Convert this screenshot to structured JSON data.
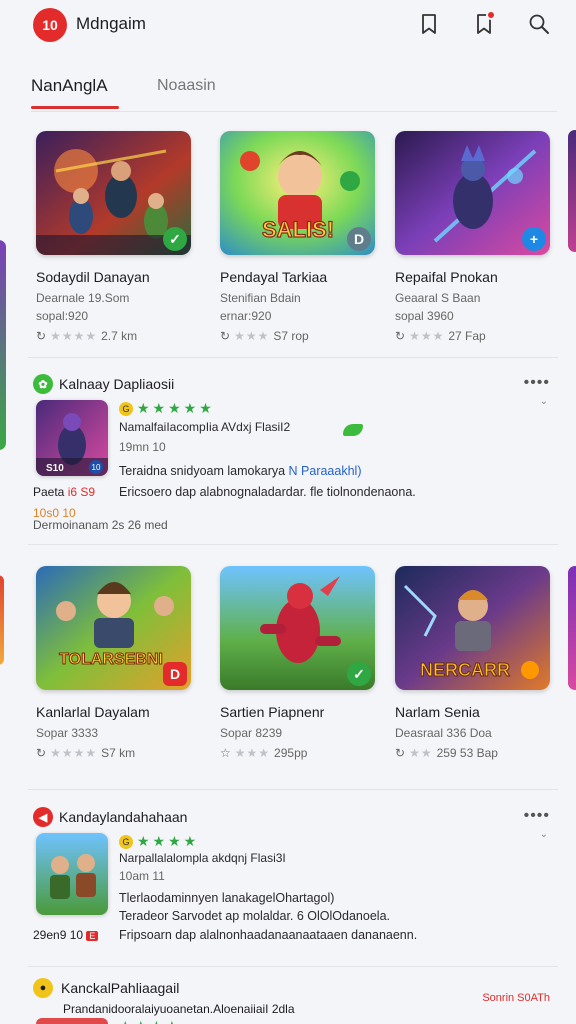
{
  "header": {
    "logo_text": "10",
    "app_title": "Mdngaim"
  },
  "tabs": {
    "active": "NanAnglA",
    "inactive": "Noaasin"
  },
  "row1": [
    {
      "title": "Sodaydil Danayan",
      "sub": "Dearnale 19.Som",
      "meta1": "sopal:920",
      "rating_text": "2.7 km",
      "badge": "✓",
      "badge_color": "#2fa843"
    },
    {
      "title": "Pendayal Tarkiaa",
      "sub": "Stenifian Bdain",
      "meta1": "ernar:920",
      "rating_text": "S7 rop",
      "badge": "D",
      "badge_color": "#607d8b",
      "thumb_text": "SALIS!"
    },
    {
      "title": "Repaifal Pnokan",
      "sub": "Geaaral S Baan",
      "meta1": "sopal 3960",
      "rating_text": "27 Fap",
      "badge": "+",
      "badge_color": "#1e88e5"
    }
  ],
  "review1": {
    "title": "Kalnaay Dapliaosii",
    "line1": "NamalfaiIacompIia AVdxj FlasiI2",
    "line2": "19mn 10",
    "body1_a": "Teraidna snidyoam lamokarya ",
    "body1_b": "N Paraaakhl)",
    "body2": "Ericsoero dap alabnognaladardar. fle tiolnondenaona.",
    "side1_a": "Paeta ",
    "side1_b": "i6 S9",
    "side2": "10s0 10",
    "side3": "Dermoinanam 2s 26 med",
    "thumb_label": "S10",
    "thumb_label2": "10",
    "rating_icon": "G",
    "more": "••••"
  },
  "row2": [
    {
      "title": "Kanlarlal Dayalam",
      "sub": "Sopar 3333",
      "rating_text": "S7 km",
      "badge": "D",
      "badge_color": "#e32b2b",
      "thumb_text": "TOLARSEBNI"
    },
    {
      "title": "Sartien Piapnenr",
      "sub": "Sopar 8239",
      "rating_text": "295pp",
      "badge": "✓",
      "badge_color": "#2fa843"
    },
    {
      "title": "Narlam Senia",
      "sub": "Deasraal 336 Doa",
      "rating_text": "259 53 Bap",
      "badge": "",
      "badge_color": "#ff9800",
      "thumb_text": "NERCARR"
    }
  ],
  "review2": {
    "title": "Kandaylandahahaan",
    "line1": "Narpallalalompla akdqnj Flasi3I",
    "line2": "10am 11",
    "body1": "Tlerlaodaminnyen lanakagelOhartagol)",
    "body2": "Teradeor Sarvodet ap molaldar. 6 OlOlOdanoela.",
    "body3": "Fripsoarn dap alalnonhaadanaanaataaen dananaenn.",
    "side": "29en9 10",
    "side_badge": "E",
    "rating_icon": "G",
    "more": "••••"
  },
  "review3": {
    "title": "KanckalPahliaagail",
    "line1": "Prandanidooralaiyuoanetan.AloenaiiaiI 2dla",
    "right": "Sonrin S0ATh"
  }
}
